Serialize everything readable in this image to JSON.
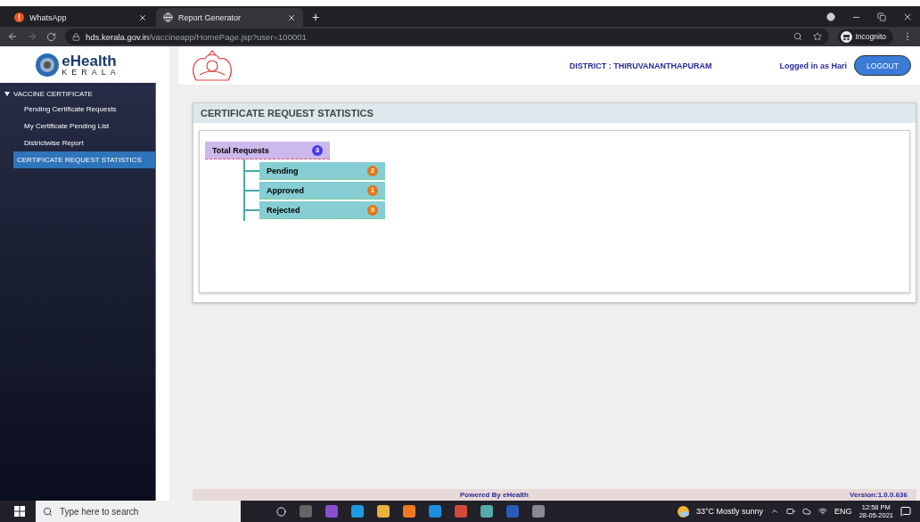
{
  "browser": {
    "tabs": [
      {
        "title": "WhatsApp",
        "selected": false,
        "kind": "alert"
      },
      {
        "title": "Report Generator",
        "selected": true,
        "kind": "globe"
      }
    ],
    "new_tab": "+",
    "url_host": "hds.kerala.gov.in",
    "url_path": "/vaccineapp/HomePage.jsp?user=100001",
    "profile": "Incognito"
  },
  "logo": {
    "name": "eHealth",
    "subtitle": "KERALA"
  },
  "sidebar": {
    "section": {
      "label": "VACCINE CERTIFICATE",
      "expanded": true,
      "children": [
        {
          "label": "Pending Certificate Requests",
          "selected": false
        },
        {
          "label": "My Certificate Pending List",
          "selected": false
        },
        {
          "label": "Districtwise Report",
          "selected": false
        },
        {
          "label": "CERTIFICATE REQUEST STATISTICS",
          "selected": true
        }
      ]
    }
  },
  "header": {
    "district": "DISTRICT : THIRUVANANTHAPURAM",
    "user": "Logged in as Hari",
    "logout": "LOGOUT"
  },
  "panel": {
    "title": "CERTIFICATE REQUEST STATISTICS",
    "total": {
      "label": "Total Requests",
      "count": "3"
    },
    "items": [
      {
        "label": "Pending",
        "count": "2"
      },
      {
        "label": "Approved",
        "count": "1"
      },
      {
        "label": "Rejected",
        "count": "0"
      }
    ]
  },
  "footer": {
    "powered": "Powered By eHealth",
    "version": "Version:1.0.0.636"
  },
  "taskbar": {
    "search_placeholder": "Type here to search",
    "weather": "33°C  Mostly sunny",
    "language": "ENG",
    "time": "12:58 PM",
    "date": "28-05-2021"
  }
}
